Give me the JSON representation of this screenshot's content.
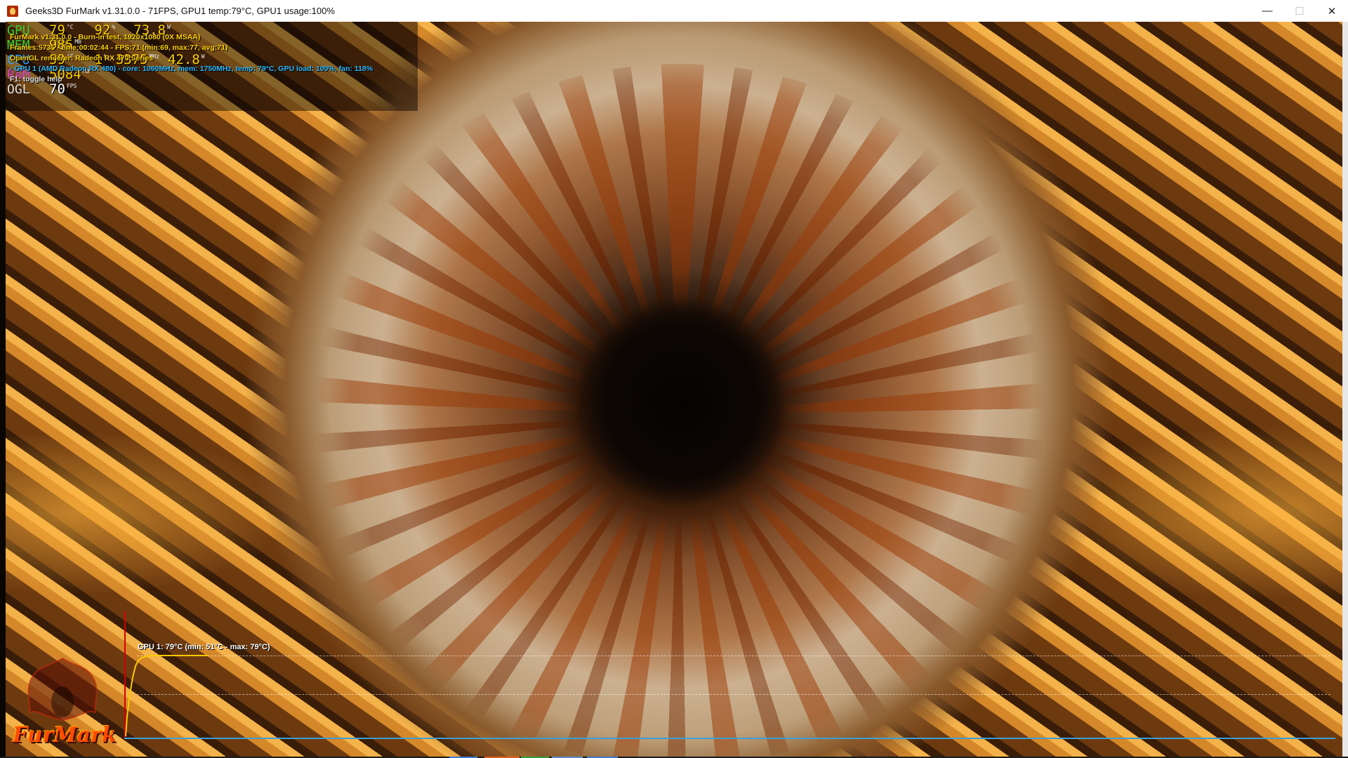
{
  "window": {
    "title": "Geeks3D FurMark v1.31.0.0 - 71FPS, GPU1 temp:79°C, GPU1 usage:100%",
    "minimize_glyph": "—",
    "maximize_glyph": "☐",
    "close_glyph": "✕"
  },
  "osd": {
    "rows": [
      {
        "label": "GPU",
        "label_color": "#33cc33",
        "v1": "79",
        "u1": "°C",
        "v2": "92",
        "u2": "%",
        "v3": "73.8",
        "u3": "W"
      },
      {
        "label": "MEM",
        "label_color": "#33cc33",
        "v1": "985",
        "u1": "MB"
      },
      {
        "label": "CPU",
        "label_color": "#2aa0ff",
        "v1": "59",
        "u1": "°C",
        "v2": "1",
        "u2": "%",
        "v3": "3375",
        "u3": "MHz",
        "v4": "42.8",
        "u4": "W"
      },
      {
        "label": "RAM",
        "label_color": "#d040d0",
        "v1": "5084",
        "u1": "MB"
      },
      {
        "label": "OGL",
        "label_color": "#dddddd",
        "v1": "70",
        "u1": "FPS"
      }
    ],
    "info_lines": [
      {
        "text": "FurMark v1.31.0.0 - Burn-in test, 1920x1080 (0X MSAA)",
        "color": "#ffd200"
      },
      {
        "text": "Frames:5735 - time:00:02:44 - FPS:71 (min:69, max:77, avg:71)",
        "color": "#ffd200"
      },
      {
        "text": "OpenGL renderer: Radeon RX 470 Series",
        "color": "#ffd200"
      },
      {
        "text": "- GPU 1 (AMD Radeon RX 480) - core: 1060MHz, mem: 1750MHz, temp: 79°C, GPU load: 100%, fan: 118%",
        "color": "#2ab8ff"
      },
      {
        "text": "F1: toggle help",
        "color": "#dddddd"
      }
    ]
  },
  "graph": {
    "title": "GPU 1: 79°C (min: 51°C - max: 79°C)",
    "line_color": "#ffc800",
    "axis_x_color": "#3aa0d8",
    "axis_y_color": "#d40000"
  },
  "logo": {
    "text": "FurMark"
  },
  "colors": {
    "eye_center": "#050302",
    "iris": "#a76a3a",
    "fur_light": "#c9ad8c",
    "background_orange": "#f3b24a"
  }
}
